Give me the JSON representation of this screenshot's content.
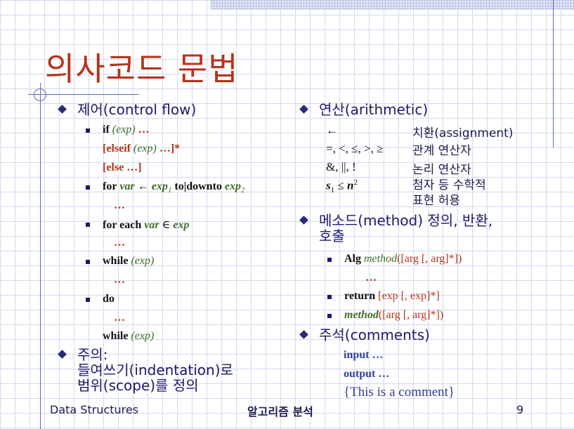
{
  "title": "의사코드 문법",
  "left": {
    "heading": "제어(control flow)",
    "if_kw": "if",
    "if_exp": "(exp)",
    "if_dots": "…",
    "elseif_open": "[elseif",
    "elseif_exp": "(exp)",
    "elseif_close": "…]*",
    "else_text": "[else …]",
    "for_kw": "for",
    "for_var": "var",
    "for_arrow": "←",
    "for_exp1": "exp",
    "for_sub1": "1",
    "for_to": "to|downto",
    "for_exp2": "exp",
    "for_sub2": "2",
    "for_dots": "…",
    "foreach_kw": "for each",
    "foreach_var": "var",
    "foreach_in": "∈",
    "foreach_exp": "exp",
    "foreach_dots": "…",
    "while_kw": "while",
    "while_exp": "(exp)",
    "while_dots": "…",
    "do_kw": "do",
    "do_dots": "…",
    "dowhile_kw": "while",
    "dowhile_exp": "(exp)",
    "note_line1": "주의:",
    "note_line2": "들여쓰기(indentation)로",
    "note_line3": "범위(scope)를 정의"
  },
  "right": {
    "heading": "연산(arithmetic)",
    "ops": [
      {
        "op": "←",
        "desc": "치환(assignment)"
      },
      {
        "op": "=, <, ≤, >, ≥",
        "desc": "관계 연산자"
      },
      {
        "op": "&, ||, !",
        "desc": "논리 연산자"
      },
      {
        "op_s": "s",
        "op_sub": "1",
        "op_le": "≤",
        "op_n": "n",
        "op_sup": "2",
        "desc1": "첨자 등 수학적",
        "desc2": "표현 허용"
      }
    ],
    "method_heading1": "메소드(method) 정의, 반환,",
    "method_heading2": "호출",
    "alg_kw": "Alg",
    "alg_method": "method",
    "alg_args": "([arg [, arg]*])",
    "alg_dots": "…",
    "return_kw": "return",
    "return_args": "[exp [, exp]*]",
    "call_method": "method",
    "call_args": "([arg [, arg]*])",
    "comment_heading": "주석(comments)",
    "input_text": "input …",
    "output_text": "output …",
    "comment_text": "{This is a comment}"
  },
  "footer": {
    "left": "Data Structures",
    "center": "알고리즘 분석",
    "page": "9"
  }
}
